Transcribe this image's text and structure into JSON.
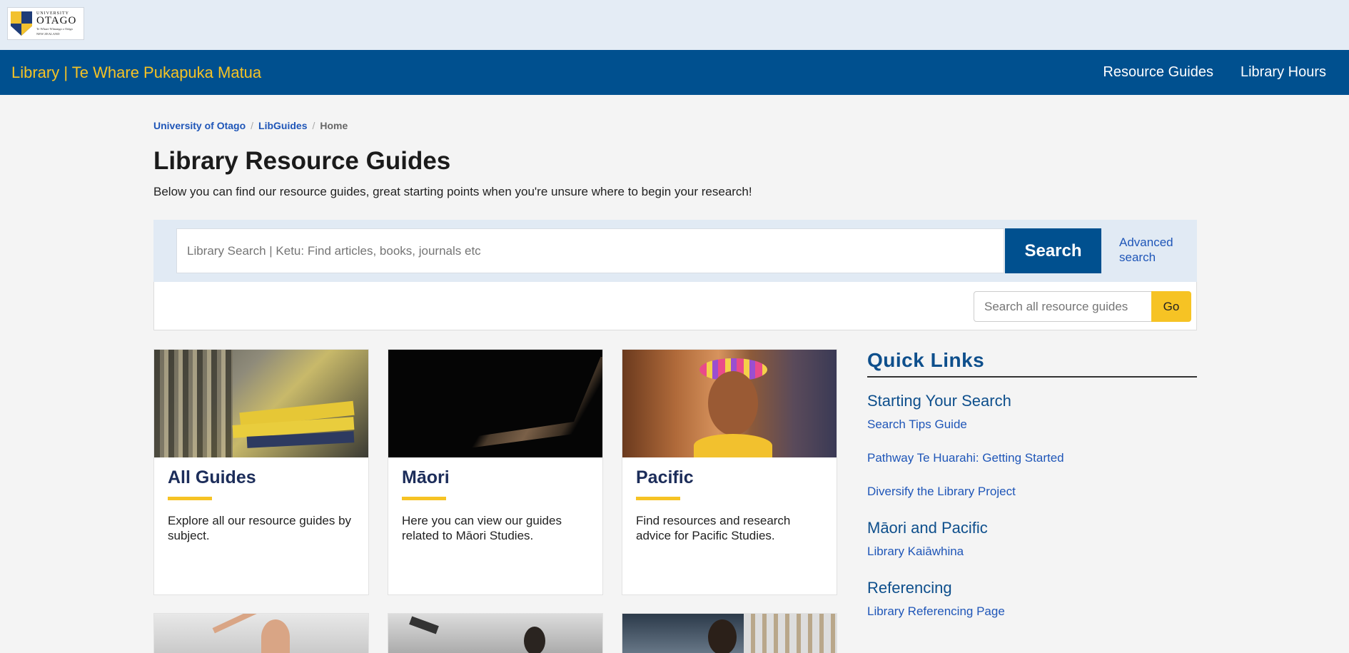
{
  "header": {
    "logo": {
      "line1": "UNIVERSITY",
      "line2": "OTAGO",
      "line3": "Te Whare Wānanga o Otāgo",
      "line4": "NEW ZEALAND"
    },
    "site_title": "Library | Te Whare Pukapuka Matua",
    "nav": [
      {
        "label": "Resource Guides"
      },
      {
        "label": "Library Hours"
      }
    ]
  },
  "breadcrumb": [
    {
      "label": "University of Otago"
    },
    {
      "label": "LibGuides"
    },
    {
      "label": "Home"
    }
  ],
  "page": {
    "title": "Library Resource Guides",
    "description": "Below you can find our resource guides, great starting points when you're unsure where to begin your research!"
  },
  "search": {
    "placeholder": "Library Search | Ketu: Find articles, books, journals etc",
    "button_label": "Search",
    "advanced_label": "Advanced search"
  },
  "guide_search": {
    "placeholder": "Search all resource guides",
    "button_label": "Go"
  },
  "cards": [
    {
      "title": "All Guides",
      "text": "Explore all our resource guides by subject."
    },
    {
      "title": "Māori",
      "text": "Here you can view our guides related to Māori Studies."
    },
    {
      "title": "Pacific",
      "text": "Find resources and research advice for Pacific Studies."
    }
  ],
  "quick_links": {
    "title": "Quick Links",
    "sections": [
      {
        "heading": "Starting Your Search",
        "links": [
          "Search Tips Guide",
          "Pathway Te Huarahi: Getting Started",
          "Diversify the Library Project"
        ]
      },
      {
        "heading": "Māori and Pacific",
        "links": [
          "Library Kaiāwhina"
        ]
      },
      {
        "heading": "Referencing",
        "links": [
          "Library Referencing Page"
        ]
      }
    ]
  },
  "colors": {
    "nav_bg": "#00508f",
    "accent_yellow": "#f6c324",
    "link_blue": "#1f56b8",
    "heading_blue": "#0e4f8c"
  }
}
